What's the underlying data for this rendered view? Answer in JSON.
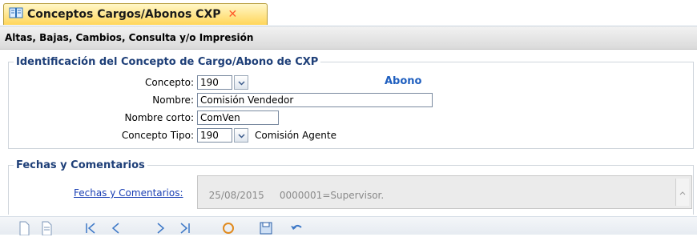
{
  "tab": {
    "title": "Conceptos Cargos/Abonos CXP",
    "close": "✕"
  },
  "subheader": "Altas, Bajas, Cambios, Consulta y/o Impresión",
  "identificacion": {
    "legend": "Identificación del Concepto de Cargo/Abono de CXP",
    "concepto_label": "Concepto:",
    "concepto_value": "190",
    "tipo_mov": "Abono",
    "nombre_label": "Nombre:",
    "nombre_value": "Comisión Vendedor",
    "nombre_corto_label": "Nombre corto:",
    "nombre_corto_value": "ComVen",
    "concepto_tipo_label": "Concepto Tipo:",
    "concepto_tipo_value": "190",
    "concepto_tipo_desc": "Comisión Agente"
  },
  "fechas": {
    "legend": "Fechas y Comentarios",
    "link": "Fechas y Comentarios:",
    "text": "25/08/2015     0000001=Supervisor."
  },
  "colors": {
    "accent": "#1e3f78",
    "link": "#1a3fb4",
    "tab": "#ffd65a"
  },
  "toolbar_icons": [
    "new-icon",
    "document-icon",
    "first-record-icon",
    "previous-record-icon",
    "next-record-icon",
    "last-record-icon",
    "search-icon",
    "save-icon",
    "undo-icon"
  ]
}
